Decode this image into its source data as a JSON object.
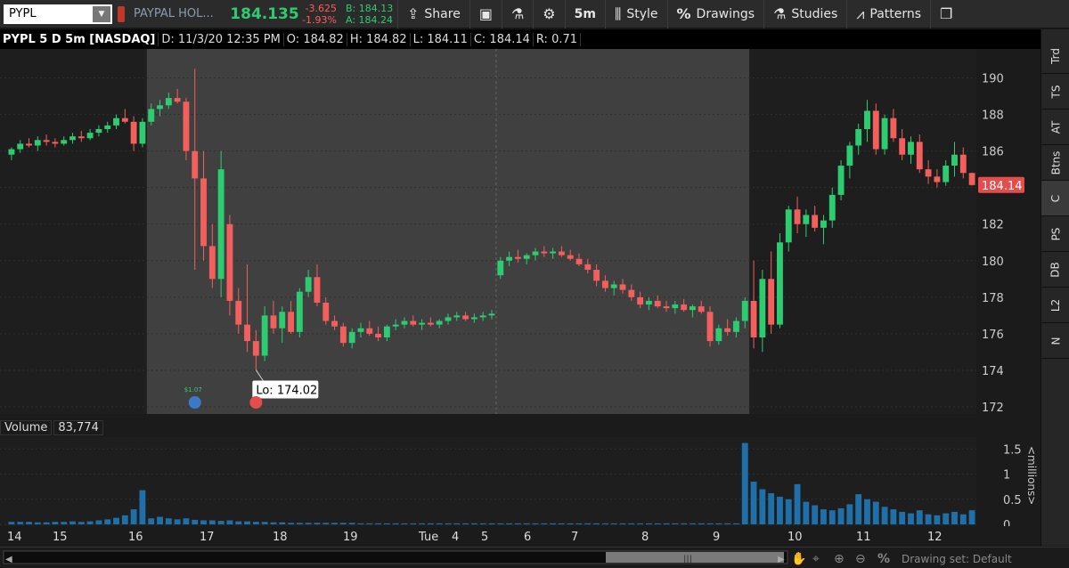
{
  "toolbar": {
    "symbol": "PYPL",
    "company": "PAYPAL HOL...",
    "last": "184.135",
    "net_change": "-3.625",
    "pct_change": "-1.93%",
    "bid": "B: 184.13",
    "ask": "A: 184.24",
    "share": "Share",
    "timeframe": "5m",
    "style": "Style",
    "drawings": "Drawings",
    "studies": "Studies",
    "patterns": "Patterns"
  },
  "header": {
    "title": "PYPL 5 D 5m [NASDAQ]",
    "date": "D: 11/3/20 12:35 PM",
    "open": "O: 184.82",
    "high": "H: 184.82",
    "low": "L: 184.11",
    "close": "C: 184.14",
    "range": "R: 0.71"
  },
  "volume": {
    "label": "Volume",
    "value": "83,774"
  },
  "sidebar": [
    "Trd",
    "TS",
    "AT",
    "Btns",
    "C",
    "PS",
    "DB",
    "L2",
    "N"
  ],
  "scroll": {
    "drawing_set": "Drawing set: Default"
  },
  "colors": {
    "up": "#2ecc71",
    "down": "#f25f5c",
    "volume": "#1f6fa8",
    "afterhours": "#404040",
    "regular": "#1e1e1e"
  },
  "chart_data": {
    "type": "candlestick",
    "price_ylim": [
      172,
      191
    ],
    "price_ticks": [
      172,
      174,
      176,
      178,
      180,
      182,
      184,
      186,
      188,
      190
    ],
    "current_price": "184.14",
    "low_annotation": "Lo: 174.02",
    "event_label": "$1.07",
    "volume_ylim": [
      0,
      1.7
    ],
    "volume_ticks": [
      "0",
      "0.5",
      "1",
      "1.5"
    ],
    "volume_unit": "<millions>",
    "x_labels": [
      "14",
      "15",
      "16",
      "17",
      "18",
      "19",
      "Tue",
      "4",
      "5",
      "6",
      "7",
      "8",
      "9",
      "10",
      "11",
      "12"
    ],
    "candles": [
      [
        185.8,
        186.2,
        185.5,
        186.1
      ],
      [
        186.1,
        186.6,
        185.9,
        186.4
      ],
      [
        186.4,
        186.7,
        186.2,
        186.3
      ],
      [
        186.3,
        186.8,
        186.0,
        186.6
      ],
      [
        186.6,
        186.9,
        186.3,
        186.5
      ],
      [
        186.5,
        186.7,
        186.2,
        186.4
      ],
      [
        186.4,
        186.8,
        186.3,
        186.6
      ],
      [
        186.6,
        187.0,
        186.4,
        186.8
      ],
      [
        186.8,
        187.1,
        186.5,
        186.7
      ],
      [
        186.7,
        187.2,
        186.6,
        187.0
      ],
      [
        187.0,
        187.4,
        186.8,
        187.2
      ],
      [
        187.2,
        187.6,
        187.0,
        187.4
      ],
      [
        187.4,
        188.0,
        187.2,
        187.8
      ],
      [
        187.8,
        188.3,
        187.5,
        187.6
      ],
      [
        187.6,
        187.9,
        186.0,
        186.4
      ],
      [
        186.4,
        187.8,
        186.2,
        187.6
      ],
      [
        187.6,
        188.6,
        187.4,
        188.3
      ],
      [
        188.3,
        188.8,
        187.9,
        188.5
      ],
      [
        188.5,
        189.2,
        188.3,
        188.9
      ],
      [
        188.9,
        189.4,
        188.6,
        188.7
      ],
      [
        188.7,
        188.9,
        185.5,
        186.0
      ],
      [
        186.0,
        190.5,
        179.5,
        184.5
      ],
      [
        184.5,
        186.0,
        180.0,
        180.8
      ],
      [
        180.8,
        182.0,
        178.5,
        179.0
      ],
      [
        179.0,
        186.0,
        178.0,
        185.0
      ],
      [
        182.0,
        182.5,
        177.0,
        177.8
      ],
      [
        177.8,
        178.5,
        176.0,
        176.5
      ],
      [
        176.5,
        179.8,
        175.0,
        175.6
      ],
      [
        175.6,
        176.2,
        174.02,
        174.8
      ],
      [
        174.8,
        177.5,
        174.5,
        177.0
      ],
      [
        177.0,
        177.8,
        176.0,
        176.3
      ],
      [
        176.3,
        177.5,
        175.5,
        177.2
      ],
      [
        177.2,
        177.8,
        176.0,
        176.1
      ],
      [
        176.1,
        178.5,
        175.8,
        178.3
      ],
      [
        178.3,
        179.5,
        178.0,
        179.1
      ],
      [
        179.1,
        179.8,
        177.5,
        177.7
      ],
      [
        177.7,
        178.0,
        176.5,
        176.7
      ],
      [
        176.7,
        177.0,
        176.2,
        176.4
      ],
      [
        176.4,
        176.6,
        175.3,
        175.5
      ],
      [
        175.5,
        176.3,
        175.2,
        176.1
      ],
      [
        176.1,
        176.6,
        175.8,
        176.3
      ],
      [
        176.3,
        176.7,
        175.9,
        176.0
      ],
      [
        176.0,
        176.4,
        175.6,
        175.8
      ],
      [
        175.8,
        176.5,
        175.6,
        176.4
      ],
      [
        176.4,
        176.8,
        176.2,
        176.5
      ],
      [
        176.5,
        176.9,
        176.3,
        176.7
      ],
      [
        176.7,
        177.0,
        176.4,
        176.5
      ],
      [
        176.5,
        176.8,
        176.2,
        176.6
      ],
      [
        176.6,
        176.9,
        176.4,
        176.5
      ],
      [
        176.5,
        176.8,
        176.3,
        176.7
      ],
      [
        176.7,
        177.1,
        176.5,
        176.9
      ],
      [
        176.9,
        177.2,
        176.7,
        177.0
      ],
      [
        177.0,
        177.2,
        176.7,
        176.8
      ],
      [
        176.8,
        177.1,
        176.6,
        176.9
      ],
      [
        176.9,
        177.2,
        176.7,
        177.0
      ],
      [
        177.0,
        177.3,
        176.8,
        177.1
      ],
      [
        179.2,
        180.2,
        179.0,
        180.0
      ],
      [
        180.0,
        180.5,
        179.7,
        180.2
      ],
      [
        180.2,
        180.6,
        179.9,
        180.1
      ],
      [
        180.1,
        180.4,
        179.8,
        180.3
      ],
      [
        180.3,
        180.7,
        180.0,
        180.5
      ],
      [
        180.5,
        180.8,
        180.2,
        180.4
      ],
      [
        180.4,
        180.7,
        180.1,
        180.5
      ],
      [
        180.5,
        180.8,
        180.2,
        180.3
      ],
      [
        180.3,
        180.6,
        180.0,
        180.1
      ],
      [
        180.1,
        180.4,
        179.7,
        179.8
      ],
      [
        179.8,
        180.1,
        179.3,
        179.5
      ],
      [
        179.5,
        179.8,
        178.6,
        178.9
      ],
      [
        178.9,
        179.2,
        178.3,
        178.5
      ],
      [
        178.5,
        178.9,
        178.1,
        178.7
      ],
      [
        178.7,
        179.0,
        178.2,
        178.4
      ],
      [
        178.4,
        178.7,
        177.8,
        178.0
      ],
      [
        178.0,
        178.3,
        177.4,
        177.6
      ],
      [
        177.6,
        178.0,
        177.3,
        177.8
      ],
      [
        177.8,
        178.1,
        177.4,
        177.5
      ],
      [
        177.5,
        177.8,
        177.2,
        177.4
      ],
      [
        177.4,
        177.8,
        177.1,
        177.6
      ],
      [
        177.6,
        177.9,
        177.2,
        177.3
      ],
      [
        177.3,
        177.6,
        176.9,
        177.5
      ],
      [
        177.5,
        177.8,
        177.1,
        177.2
      ],
      [
        177.2,
        177.5,
        175.3,
        175.6
      ],
      [
        175.6,
        176.5,
        175.4,
        176.3
      ],
      [
        176.3,
        176.8,
        175.9,
        176.1
      ],
      [
        176.1,
        176.9,
        175.8,
        176.7
      ],
      [
        176.7,
        178.0,
        176.3,
        177.8
      ],
      [
        177.8,
        180.0,
        175.2,
        175.8
      ],
      [
        175.8,
        179.5,
        175.0,
        179.0
      ],
      [
        179.0,
        180.5,
        176.0,
        176.5
      ],
      [
        176.5,
        181.5,
        176.3,
        181.0
      ],
      [
        181.0,
        183.0,
        180.5,
        182.8
      ],
      [
        182.8,
        183.5,
        181.5,
        182.0
      ],
      [
        182.0,
        182.8,
        181.3,
        182.5
      ],
      [
        182.5,
        183.0,
        181.6,
        181.8
      ],
      [
        181.8,
        182.5,
        180.9,
        182.2
      ],
      [
        182.2,
        184.0,
        181.8,
        183.6
      ],
      [
        183.6,
        185.5,
        183.3,
        185.2
      ],
      [
        185.2,
        186.5,
        184.5,
        186.3
      ],
      [
        186.3,
        187.5,
        185.8,
        187.2
      ],
      [
        187.2,
        188.8,
        186.5,
        188.2
      ],
      [
        188.2,
        188.6,
        185.8,
        186.1
      ],
      [
        186.1,
        188.0,
        185.8,
        187.8
      ],
      [
        187.8,
        188.3,
        186.5,
        186.7
      ],
      [
        186.7,
        187.2,
        185.5,
        185.8
      ],
      [
        185.8,
        186.8,
        185.3,
        186.5
      ],
      [
        186.5,
        186.9,
        184.8,
        185.0
      ],
      [
        185.0,
        185.5,
        184.2,
        184.6
      ],
      [
        184.6,
        185.0,
        184.0,
        184.3
      ],
      [
        184.3,
        185.5,
        184.1,
        185.2
      ],
      [
        185.2,
        186.5,
        184.6,
        185.8
      ],
      [
        185.8,
        186.2,
        184.5,
        184.8
      ],
      [
        184.8,
        184.82,
        184.11,
        184.14
      ]
    ],
    "volume": [
      0.05,
      0.05,
      0.05,
      0.04,
      0.04,
      0.05,
      0.05,
      0.06,
      0.05,
      0.06,
      0.08,
      0.1,
      0.13,
      0.18,
      0.3,
      0.68,
      0.12,
      0.15,
      0.12,
      0.1,
      0.12,
      0.09,
      0.08,
      0.08,
      0.07,
      0.08,
      0.06,
      0.06,
      0.05,
      0.05,
      0.04,
      0.04,
      0.03,
      0.03,
      0.03,
      0.03,
      0.03,
      0.03,
      0.03,
      0.03,
      0.02,
      0.02,
      0.02,
      0.02,
      0.02,
      0.02,
      0.02,
      0.02,
      0.02,
      0.02,
      0.02,
      0.02,
      0.02,
      0.02,
      0.02,
      0.02,
      0.02,
      0.02,
      0.02,
      0.02,
      0.02,
      0.02,
      0.02,
      0.02,
      0.02,
      0.02,
      0.02,
      0.02,
      0.02,
      0.02,
      0.02,
      0.02,
      0.02,
      0.02,
      0.02,
      0.02,
      0.02,
      0.02,
      0.02,
      0.02,
      0.02,
      0.02,
      0.02,
      0.02,
      1.62,
      0.85,
      0.7,
      0.62,
      0.55,
      0.5,
      0.8,
      0.45,
      0.38,
      0.3,
      0.28,
      0.32,
      0.4,
      0.6,
      0.5,
      0.45,
      0.35,
      0.3,
      0.25,
      0.22,
      0.28,
      0.2,
      0.18,
      0.22,
      0.25,
      0.2,
      0.28
    ]
  }
}
